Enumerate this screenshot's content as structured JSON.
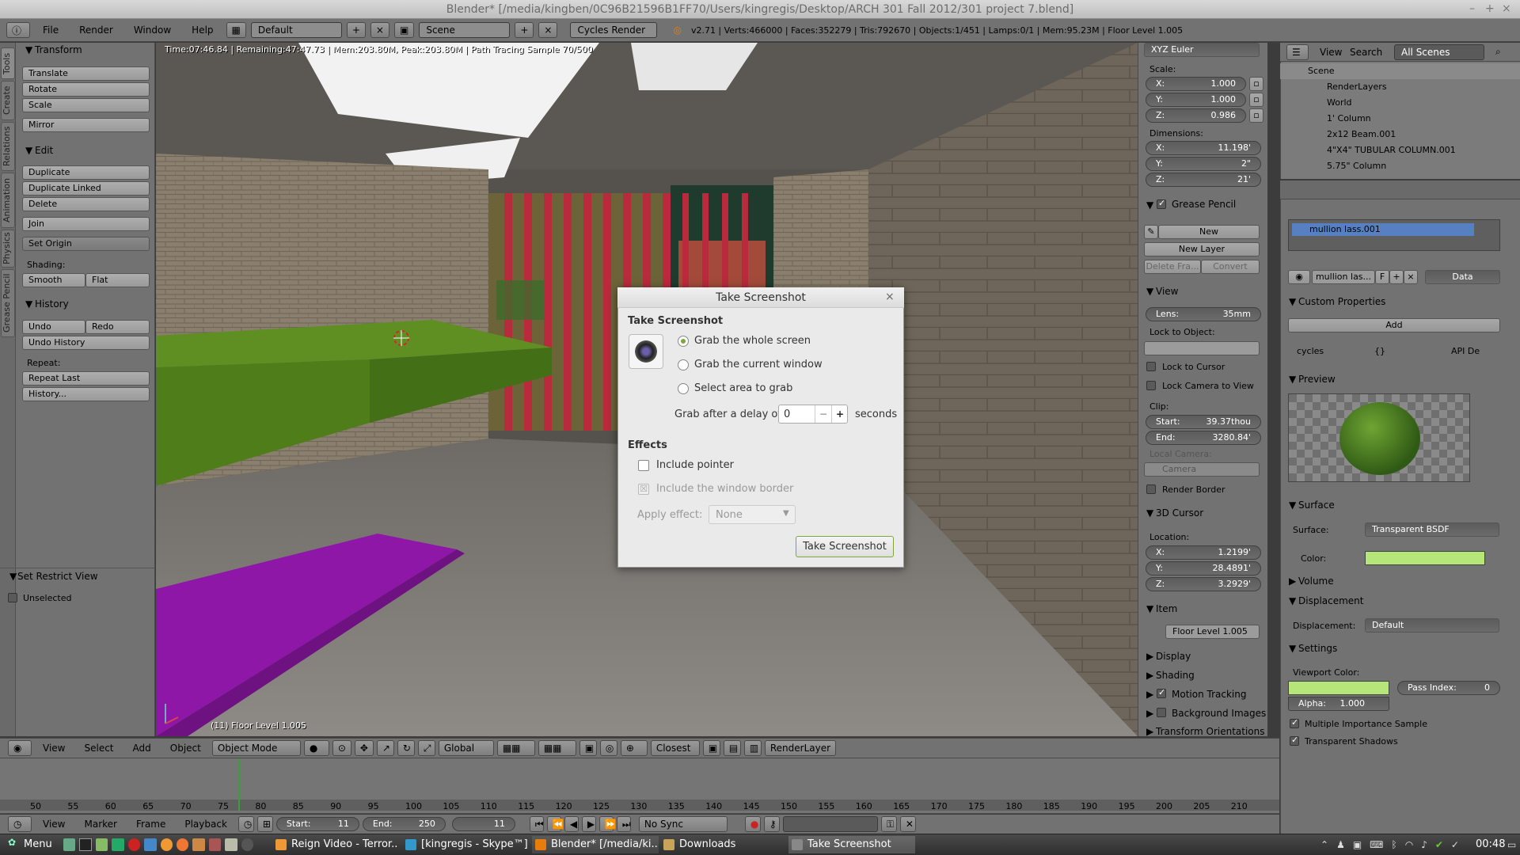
{
  "window": {
    "title": "Blender* [/media/kingben/0C96B21596B1FF70/Users/kingregis/Desktop/ARCH 301 Fall 2012/301 project 7.blend]",
    "controls": [
      "–",
      "+",
      "×"
    ]
  },
  "info_header": {
    "menus": [
      "File",
      "Render",
      "Window",
      "Help"
    ],
    "layout": "Default",
    "scene": "Scene",
    "engine": "Cycles Render",
    "stats": "v2.71 | Verts:466000 | Faces:352279 | Tris:792670 | Objects:1/451 | Lamps:0/1 | Mem:95.23M | Floor Level 1.005"
  },
  "toolshelf": {
    "tabs": [
      "Tools",
      "Create",
      "Relations",
      "Animation",
      "Physics",
      "Grease Pencil"
    ],
    "transform_title": "Transform",
    "transform": [
      "Translate",
      "Rotate",
      "Scale",
      "Mirror"
    ],
    "edit_title": "Edit",
    "edit": [
      "Duplicate",
      "Duplicate Linked",
      "Delete",
      "Join"
    ],
    "set_origin": "Set Origin",
    "shading_label": "Shading:",
    "smooth": "Smooth",
    "flat": "Flat",
    "history_title": "History",
    "undo": "Undo",
    "redo": "Redo",
    "undo_history": "Undo History",
    "repeat_label": "Repeat:",
    "repeat_last": "Repeat Last",
    "history_btn": "History...",
    "restrict_title": "Set Restrict View",
    "unselected": "Unselected"
  },
  "viewport": {
    "status": "Time:07:46.84 | Remaining:47:47.73 | Mem:203.80M, Peak:203.80M | Path Tracing Sample 70/500",
    "object_label": "(11) Floor Level 1.005"
  },
  "view3d_header": {
    "menus": [
      "View",
      "Select",
      "Add",
      "Object"
    ],
    "mode": "Object Mode",
    "orientation": "Global",
    "snap": "Closest",
    "render_layer": "RenderLayer"
  },
  "timeline": {
    "ticks": [
      "50",
      "55",
      "60",
      "65",
      "70",
      "75",
      "80",
      "85",
      "90",
      "95",
      "100",
      "105",
      "110",
      "115",
      "120",
      "125",
      "130",
      "135",
      "140",
      "145",
      "150",
      "155",
      "160",
      "165",
      "170",
      "175",
      "180",
      "185",
      "190",
      "195",
      "200",
      "205",
      "210"
    ],
    "menus": [
      "View",
      "Marker",
      "Frame",
      "Playback"
    ],
    "start": "Start:",
    "start_val": "11",
    "end": "End:",
    "end_val": "250",
    "current": "11",
    "sync": "No Sync"
  },
  "npanel": {
    "rotation_mode": "XYZ Euler",
    "scale_label": "Scale:",
    "scale": [
      {
        "k": "X:",
        "v": "1.000"
      },
      {
        "k": "Y:",
        "v": "1.000"
      },
      {
        "k": "Z:",
        "v": "0.986"
      }
    ],
    "dimensions_label": "Dimensions:",
    "dimensions": [
      {
        "k": "X:",
        "v": "11.198'"
      },
      {
        "k": "Y:",
        "v": "2\""
      },
      {
        "k": "Z:",
        "v": "21'"
      }
    ],
    "grease_pencil": "Grease Pencil",
    "new": "New",
    "new_layer": "New Layer",
    "delete_frame": "Delete Fra...",
    "convert": "Convert",
    "view": "View",
    "lens_k": "Lens:",
    "lens_v": "35mm",
    "lock_to_object": "Lock to Object:",
    "lock_to_cursor": "Lock to Cursor",
    "lock_camera": "Lock Camera to View",
    "clip": "Clip:",
    "clip_start_k": "Start:",
    "clip_start_v": "39.37thou",
    "clip_end_k": "End:",
    "clip_end_v": "3280.84'",
    "local_camera": "Local Camera:",
    "camera": "Camera",
    "render_border": "Render Border",
    "cursor_title": "3D Cursor",
    "location_label": "Location:",
    "cursor": [
      {
        "k": "X:",
        "v": "1.2199'"
      },
      {
        "k": "Y:",
        "v": "28.4891'"
      },
      {
        "k": "Z:",
        "v": "3.2929'"
      }
    ],
    "item_title": "Item",
    "item_name": "Floor Level 1.005",
    "display": "Display",
    "shading": "Shading",
    "motion_tracking": "Motion Tracking",
    "background_images": "Background Images",
    "transform_orientations": "Transform Orientations"
  },
  "outliner": {
    "menus": [
      "View",
      "Search"
    ],
    "filter": "All Scenes",
    "rows": [
      "Scene",
      "RenderLayers",
      "World",
      "1' Column",
      "2x12 Beam.001",
      "4\"X4\" TUBULAR COLUMN.001",
      "5.75\" Column"
    ]
  },
  "properties": {
    "slot": "mullion lass.001",
    "material_name": "mullion las...",
    "fake_user": "F",
    "link": "Data",
    "custom_props": "Custom Properties",
    "add": "Add",
    "cycles": "cycles",
    "cycles_val": "{}",
    "api": "API De",
    "preview": "Preview",
    "surface_title": "Surface",
    "surface_label": "Surface:",
    "surface_val": "Transparent BSDF",
    "color_label": "Color:",
    "color_hex": "#b6e57a",
    "volume": "Volume",
    "displacement_title": "Displacement",
    "displacement_label": "Displacement:",
    "displacement_val": "Default",
    "settings": "Settings",
    "viewport_color": "Viewport Color:",
    "pass_index_k": "Pass Index:",
    "pass_index_v": "0",
    "alpha_k": "Alpha:",
    "alpha_v": "1.000",
    "mis": "Multiple Importance Sample",
    "transparent_shadows": "Transparent Shadows"
  },
  "dialog": {
    "title": "Take Screenshot",
    "heading": "Take Screenshot",
    "opt_whole": "Grab the whole screen",
    "opt_window": "Grab the current window",
    "opt_area": "Select area to grab",
    "delay_label": "Grab after a delay of",
    "delay_value": "0",
    "seconds": "seconds",
    "effects": "Effects",
    "include_pointer": "Include pointer",
    "include_border": "Include the window border",
    "apply_effect": "Apply effect:",
    "effect_value": "None",
    "button": "Take Screenshot"
  },
  "taskbar": {
    "menu": "Menu",
    "tasks": [
      "Reign Video - Terror...",
      "[kingregis - Skype™]",
      "Blender* [/media/ki...",
      "Downloads",
      "Take Screenshot"
    ],
    "clock": "00:48"
  },
  "colors": {
    "accent_blue": "#5680c2",
    "dialog_green": "#7aa83d",
    "viewport_color": "#b6e57a"
  }
}
